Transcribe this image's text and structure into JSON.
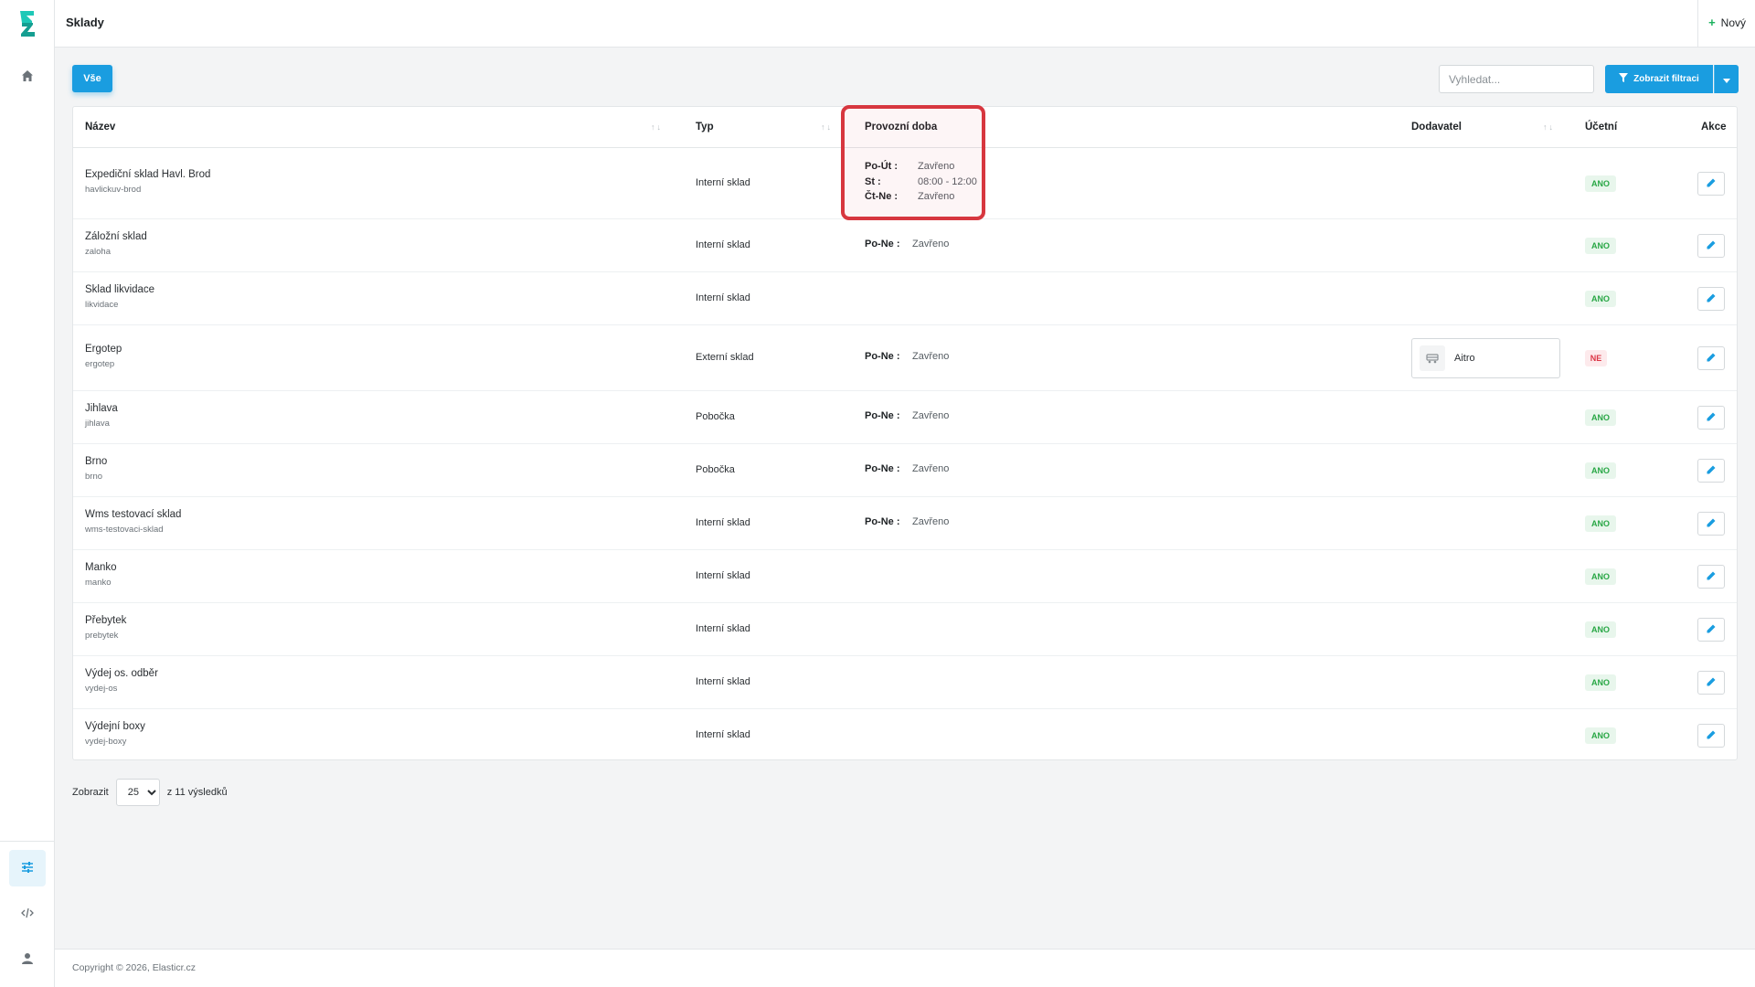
{
  "header": {
    "title": "Sklady",
    "new_label": "Nový"
  },
  "toolbar": {
    "all_label": "Vše",
    "search_placeholder": "Vyhledat...",
    "filter_label": "Zobrazit filtraci"
  },
  "table": {
    "columns": {
      "name": "Název",
      "type": "Typ",
      "hours": "Provozní doba",
      "supplier": "Dodavatel",
      "accounting": "Účetní",
      "actions": "Akce"
    },
    "rows": [
      {
        "name": "Expediční sklad Havl. Brod",
        "slug": "havlickuv-brod",
        "type": "Interní sklad",
        "hours": [
          {
            "day": "Po-Út :",
            "value": "Zavřeno"
          },
          {
            "day": "St :",
            "value": "08:00 - 12:00"
          },
          {
            "day": "Čt-Ne :",
            "value": "Zavřeno"
          }
        ],
        "supplier": "",
        "accounting": "ANO"
      },
      {
        "name": "Záložní sklad",
        "slug": "zaloha",
        "type": "Interní sklad",
        "hours": [
          {
            "day": "Po-Ne :",
            "value": "Zavřeno"
          }
        ],
        "supplier": "",
        "accounting": "ANO"
      },
      {
        "name": "Sklad likvidace",
        "slug": "likvidace",
        "type": "Interní sklad",
        "hours": [],
        "supplier": "",
        "accounting": "ANO"
      },
      {
        "name": "Ergotep",
        "slug": "ergotep",
        "type": "Externí sklad",
        "hours": [
          {
            "day": "Po-Ne :",
            "value": "Zavřeno"
          }
        ],
        "supplier": "Aitro",
        "accounting": "NE"
      },
      {
        "name": "Jihlava",
        "slug": "jihlava",
        "type": "Pobočka",
        "hours": [
          {
            "day": "Po-Ne :",
            "value": "Zavřeno"
          }
        ],
        "supplier": "",
        "accounting": "ANO"
      },
      {
        "name": "Brno",
        "slug": "brno",
        "type": "Pobočka",
        "hours": [
          {
            "day": "Po-Ne :",
            "value": "Zavřeno"
          }
        ],
        "supplier": "",
        "accounting": "ANO"
      },
      {
        "name": "Wms testovací sklad",
        "slug": "wms-testovaci-sklad",
        "type": "Interní sklad",
        "hours": [
          {
            "day": "Po-Ne :",
            "value": "Zavřeno"
          }
        ],
        "supplier": "",
        "accounting": "ANO"
      },
      {
        "name": "Manko",
        "slug": "manko",
        "type": "Interní sklad",
        "hours": [],
        "supplier": "",
        "accounting": "ANO"
      },
      {
        "name": "Přebytek",
        "slug": "prebytek",
        "type": "Interní sklad",
        "hours": [],
        "supplier": "",
        "accounting": "ANO"
      },
      {
        "name": "Výdej os. odběr",
        "slug": "vydej-os",
        "type": "Interní sklad",
        "hours": [],
        "supplier": "",
        "accounting": "ANO"
      },
      {
        "name": "Výdejní boxy",
        "slug": "vydej-boxy",
        "type": "Interní sklad",
        "hours": [],
        "supplier": "",
        "accounting": "ANO"
      }
    ]
  },
  "pager": {
    "show_label": "Zobrazit",
    "page_size": "25",
    "options": [
      "25"
    ],
    "results_label": "z 11 výsledků"
  },
  "footer": {
    "copyright": "Copyright © 2026, Elasticr.cz"
  },
  "icons": {
    "logo": "elasticr-logo",
    "home": "home-icon",
    "settings": "sliders-icon",
    "code": "code-icon",
    "user": "user-icon",
    "filter": "filter-icon",
    "edit": "pencil-icon",
    "supplier": "truck-icon"
  },
  "colors": {
    "primary": "#1a9de0",
    "logo": "#1ec8b7",
    "success": "#28a745",
    "danger": "#dc3545",
    "highlight": "#d7373f"
  }
}
